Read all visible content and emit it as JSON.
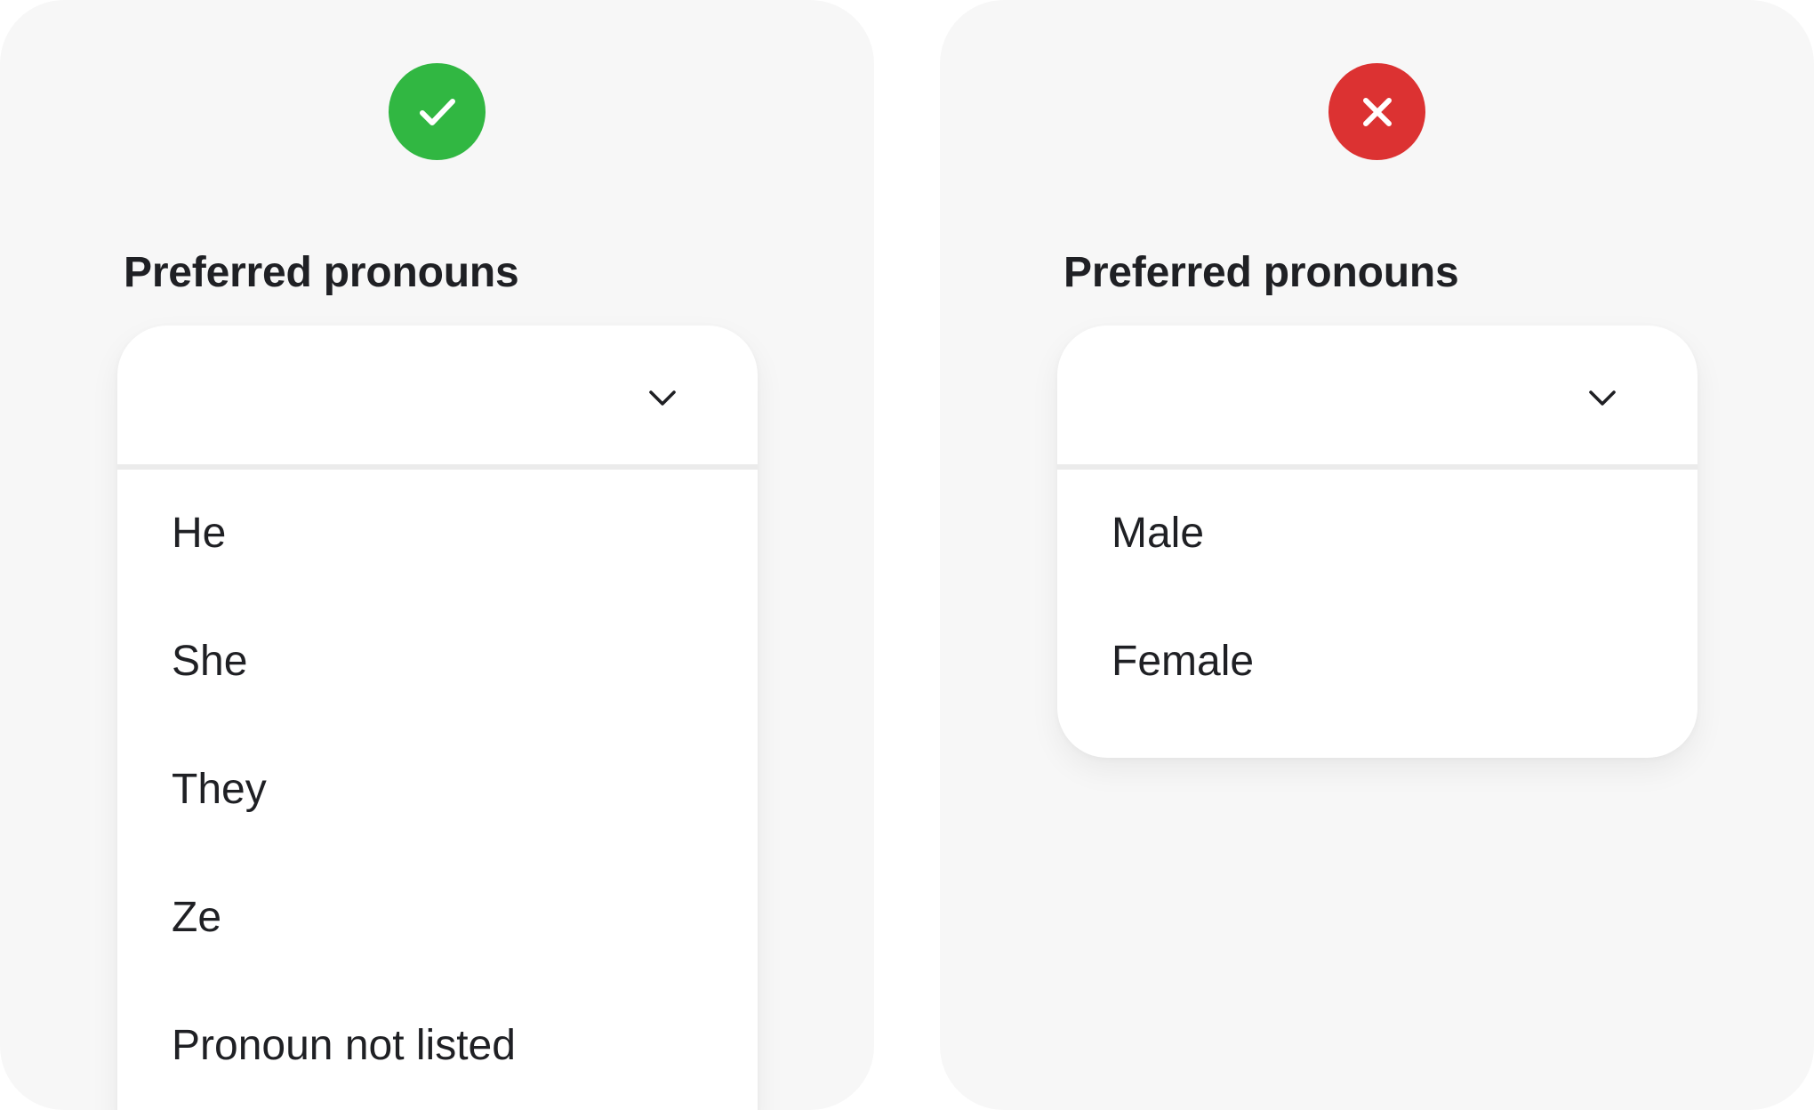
{
  "colors": {
    "good": "#31b742",
    "bad": "#dc3232",
    "panel_background": "#f7f7f7",
    "text": "#1f2024"
  },
  "good_example": {
    "badge_icon": "checkmark-icon",
    "label": "Preferred pronouns",
    "selected_value": "",
    "options": [
      "He",
      "She",
      "They",
      "Ze",
      "Pronoun not listed"
    ]
  },
  "bad_example": {
    "badge_icon": "close-icon",
    "label": "Preferred pronouns",
    "selected_value": "",
    "options": [
      "Male",
      "Female"
    ]
  }
}
